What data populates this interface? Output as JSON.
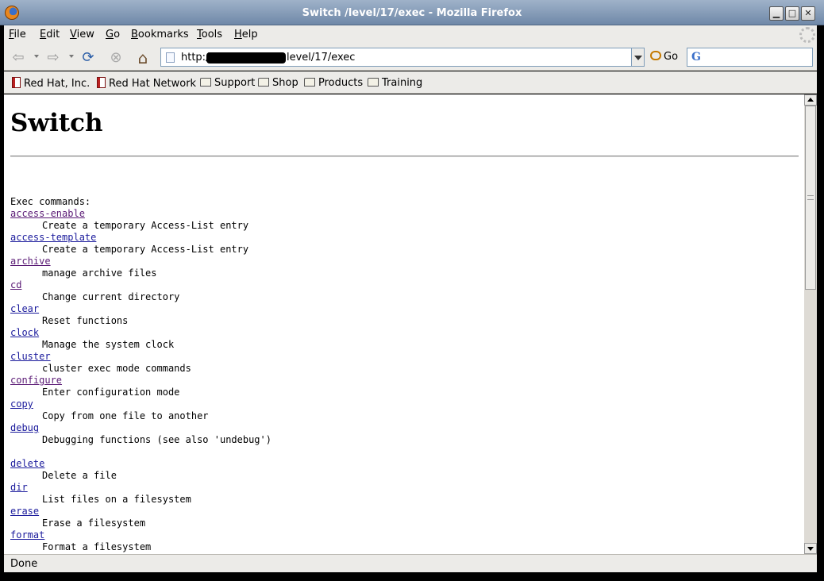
{
  "window": {
    "title": "Switch /level/17/exec - Mozilla Firefox",
    "minimize_glyph": "▁",
    "maximize_glyph": "□",
    "close_glyph": "✕"
  },
  "menu": [
    "File",
    "Edit",
    "View",
    "Go",
    "Bookmarks",
    "Tools",
    "Help"
  ],
  "navbar": {
    "back_icon": "back-arrow-icon",
    "forward_icon": "forward-arrow-icon",
    "reload_icon": "reload-icon",
    "stop_icon": "stop-icon",
    "home_icon": "home-icon",
    "url_prefix": "http://",
    "url_suffix": "level/17/exec",
    "go_label": "Go",
    "search_engine_glyph": "G"
  },
  "bookmarks": [
    {
      "label": "Red Hat, Inc.",
      "icon": "bookmark-icon"
    },
    {
      "label": "Red Hat Network",
      "icon": "bookmark-icon"
    },
    {
      "label": "Support",
      "icon": "folder-icon"
    },
    {
      "label": "Shop",
      "icon": "folder-icon"
    },
    {
      "label": "Products",
      "icon": "folder-icon"
    },
    {
      "label": "Training",
      "icon": "folder-icon"
    }
  ],
  "page": {
    "heading": "Switch",
    "intro": "Exec commands:",
    "commands": [
      {
        "name": "access-enable",
        "desc": "Create a temporary Access-List entry",
        "visited": true
      },
      {
        "name": "access-template",
        "desc": "Create a temporary Access-List entry",
        "visited": false
      },
      {
        "name": "archive",
        "desc": "manage archive files",
        "visited": true
      },
      {
        "name": "cd",
        "desc": "Change current directory",
        "visited": true
      },
      {
        "name": "clear",
        "desc": "Reset functions",
        "visited": false
      },
      {
        "name": "clock",
        "desc": "Manage the system clock",
        "visited": false
      },
      {
        "name": "cluster",
        "desc": "cluster exec mode commands",
        "visited": false
      },
      {
        "name": "configure",
        "desc": "Enter configuration mode",
        "visited": true
      },
      {
        "name": "copy",
        "desc": "Copy from one file to another",
        "visited": false
      },
      {
        "name": "debug",
        "desc": "Debugging functions (see also 'undebug')",
        "visited": false,
        "gap_after": true
      },
      {
        "name": "delete",
        "desc": "Delete a file",
        "visited": false
      },
      {
        "name": "dir",
        "desc": "List files on a filesystem",
        "visited": false
      },
      {
        "name": "erase",
        "desc": "Erase a filesystem",
        "visited": false
      },
      {
        "name": "format",
        "desc": "Format a filesystem",
        "visited": false
      }
    ]
  },
  "status": "Done"
}
